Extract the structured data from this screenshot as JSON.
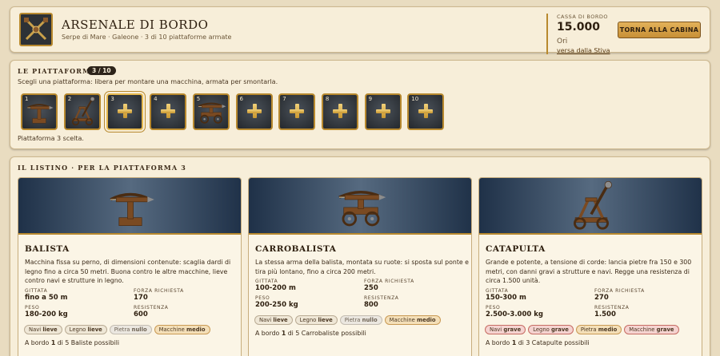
{
  "header": {
    "title": "ARSENALE DI BORDO",
    "subtitle": "Serpe di Mare · Galeone · 3 di 10 piattaforme armate",
    "cassa_label": "CASSA DI BORDO",
    "cassa_value": "15.000",
    "cassa_unit": "Ori",
    "cassa_link": "versa dalla Stiva",
    "back_button": "TORNA ALLA CABINA"
  },
  "platforms": {
    "title": "LE PIATTAFORME",
    "badge": "3 / 10",
    "hint": "Scegli una piattaforma: libera per montare una macchina, armata per smontarla.",
    "status": "Piattaforma 3 scelta.",
    "slots": [
      {
        "num": "1",
        "state": "armed",
        "machine": "balista-icon"
      },
      {
        "num": "2",
        "state": "armed",
        "machine": "catapult-icon"
      },
      {
        "num": "3",
        "state": "empty",
        "selected": true
      },
      {
        "num": "4",
        "state": "empty"
      },
      {
        "num": "5",
        "state": "armed",
        "machine": "carrobalista-icon"
      },
      {
        "num": "6",
        "state": "empty"
      },
      {
        "num": "7",
        "state": "empty"
      },
      {
        "num": "8",
        "state": "empty"
      },
      {
        "num": "9",
        "state": "empty"
      },
      {
        "num": "10",
        "state": "empty"
      }
    ]
  },
  "listino": {
    "title": "IL LISTINO · PER LA PIATTAFORMA 3",
    "stat_labels": {
      "gittata": "GITTATA",
      "forza": "FORZA RICHIESTA",
      "peso": "PESO",
      "resistenza": "RESISTENZA"
    },
    "cards": [
      {
        "name": "BALISTA",
        "desc": "Macchina fissa su perno, di dimensioni contenute: scaglia dardi di legno fino a circa 50 metri. Buona contro le altre macchine, lieve contro navi e strutture in legno.",
        "gittata": "fino a 50 m",
        "forza": "170",
        "peso": "180-200 kg",
        "resistenza": "600",
        "chips": [
          {
            "label": "Navi",
            "level": "lieve"
          },
          {
            "label": "Legno",
            "level": "lieve"
          },
          {
            "label": "Pietra",
            "level": "nullo"
          },
          {
            "label": "Macchine",
            "level": "medio"
          }
        ],
        "onboard_pre": "A bordo",
        "onboard_count": "1",
        "onboard_post": "di 5 Baliste possibili"
      },
      {
        "name": "CARROBALISTA",
        "desc": "La stessa arma della balista, montata su ruote: si sposta sul ponte e tira più lontano, fino a circa 200 metri.",
        "gittata": "100-200 m",
        "forza": "250",
        "peso": "200-250 kg",
        "resistenza": "800",
        "chips": [
          {
            "label": "Navi",
            "level": "lieve"
          },
          {
            "label": "Legno",
            "level": "lieve"
          },
          {
            "label": "Pietra",
            "level": "nullo"
          },
          {
            "label": "Macchine",
            "level": "medio"
          }
        ],
        "onboard_pre": "A bordo",
        "onboard_count": "1",
        "onboard_post": "di 5 Carrobaliste possibili"
      },
      {
        "name": "CATAPULTA",
        "desc": "Grande e potente, a tensione di corde: lancia pietre fra 150 e 300 metri, con danni gravi a strutture e navi. Regge una resistenza di circa 1.500 unità.",
        "gittata": "150-300 m",
        "forza": "270",
        "peso": "2.500-3.000 kg",
        "resistenza": "1.500",
        "chips": [
          {
            "label": "Navi",
            "level": "grave"
          },
          {
            "label": "Legno",
            "level": "grave"
          },
          {
            "label": "Pietra",
            "level": "medio"
          },
          {
            "label": "Macchine",
            "level": "grave"
          }
        ],
        "onboard_pre": "A bordo",
        "onboard_count": "1",
        "onboard_post": "di 3 Catapulte possibili"
      }
    ]
  }
}
